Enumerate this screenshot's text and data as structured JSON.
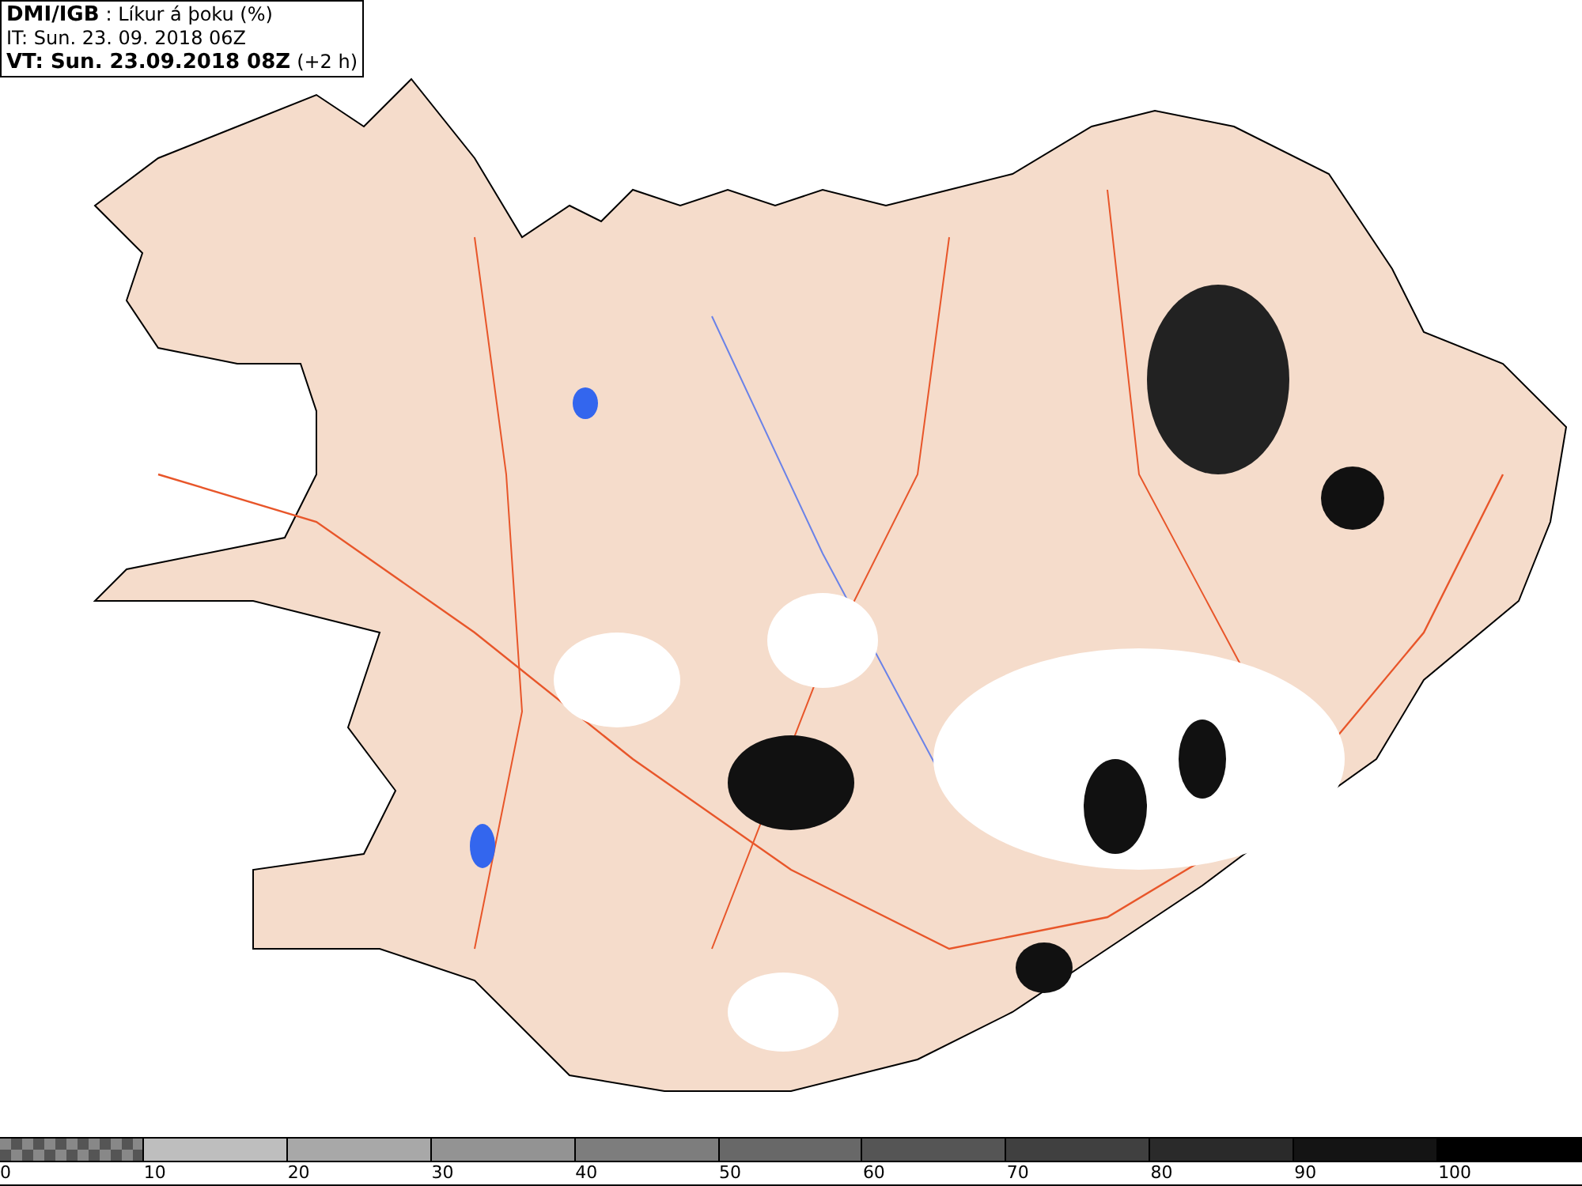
{
  "header": {
    "source": "DMI/IGB",
    "title": ": Líkur á þoku (%)",
    "issue_time": "IT: Sun. 23. 09. 2018 06Z",
    "valid_time": "VT: Sun. 23.09.2018 08Z",
    "offset": "(+2 h)"
  },
  "legend": {
    "segments": [
      {
        "kind": "pattern",
        "color": "#555555"
      },
      {
        "kind": "solid",
        "color": "#bebebe"
      },
      {
        "kind": "solid",
        "color": "#a8a8a8"
      },
      {
        "kind": "solid",
        "color": "#939393"
      },
      {
        "kind": "solid",
        "color": "#7d7d7d"
      },
      {
        "kind": "solid",
        "color": "#686868"
      },
      {
        "kind": "solid",
        "color": "#555555"
      },
      {
        "kind": "solid",
        "color": "#404040"
      },
      {
        "kind": "solid",
        "color": "#2a2a2a"
      },
      {
        "kind": "solid",
        "color": "#141414"
      },
      {
        "kind": "solid",
        "color": "#000000"
      }
    ],
    "ticks": [
      "0",
      "10",
      "20",
      "30",
      "40",
      "50",
      "60",
      "70",
      "80",
      "90",
      "100"
    ]
  }
}
